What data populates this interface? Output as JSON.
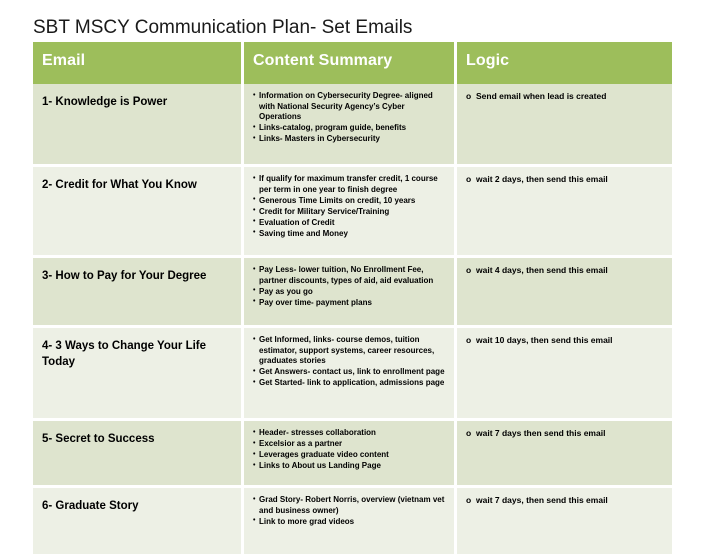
{
  "slide": {
    "title": "SBT MSCY Communication Plan- Set Emails",
    "colors": {
      "header_green": "#9DBE5B",
      "row_odd": "#DEE4CE",
      "row_even": "#EDF0E5",
      "text": "#000000",
      "header_text": "#FFFFFF",
      "background": "#FFFFFF"
    }
  },
  "table": {
    "headers": {
      "email": "Email",
      "content_summary": "Content Summary",
      "logic": "Logic"
    },
    "rows": [
      {
        "email": "1- Knowledge is Power",
        "content": [
          "Information on Cybersecurity Degree- aligned with National Security Agency’s Cyber Operations",
          "Links-catalog, program guide, benefits",
          "Links- Masters in Cybersecurity"
        ],
        "logic": "Send email when lead is created"
      },
      {
        "email": "2- Credit for What You Know",
        "content": [
          "If qualify for maximum transfer credit, 1 course per term in one year to finish degree",
          "Generous Time Limits on credit, 10 years",
          "Credit for Military Service/Training",
          "Evaluation of Credit",
          "Saving time and Money"
        ],
        "logic": "wait 2 days, then send this email"
      },
      {
        "email": "3- How to Pay for Your Degree",
        "content": [
          "Pay Less- lower tuition, No Enrollment Fee, partner discounts, types of aid, aid evaluation",
          "Pay as you go",
          "Pay over time- payment plans"
        ],
        "logic": "wait 4 days, then send this email"
      },
      {
        "email": "4- 3 Ways to Change Your Life Today",
        "content": [
          "Get Informed, links- course demos, tuition estimator, support systems, career resources, graduates stories",
          "Get Answers- contact us, link to enrollment page",
          "Get Started- link to application, admissions page"
        ],
        "logic": "wait 10 days, then send this email"
      },
      {
        "email": "5- Secret to Success",
        "content": [
          "Header- stresses collaboration",
          "Excelsior as a partner",
          "Leverages graduate video content",
          "Links to About us Landing Page"
        ],
        "logic": "wait 7 days then send this email"
      },
      {
        "email": "6- Graduate Story",
        "content": [
          "Grad Story- Robert Norris, overview (vietnam vet and business owner)",
          "Link to more grad videos"
        ],
        "logic": "wait 7 days, then send this email"
      }
    ]
  }
}
